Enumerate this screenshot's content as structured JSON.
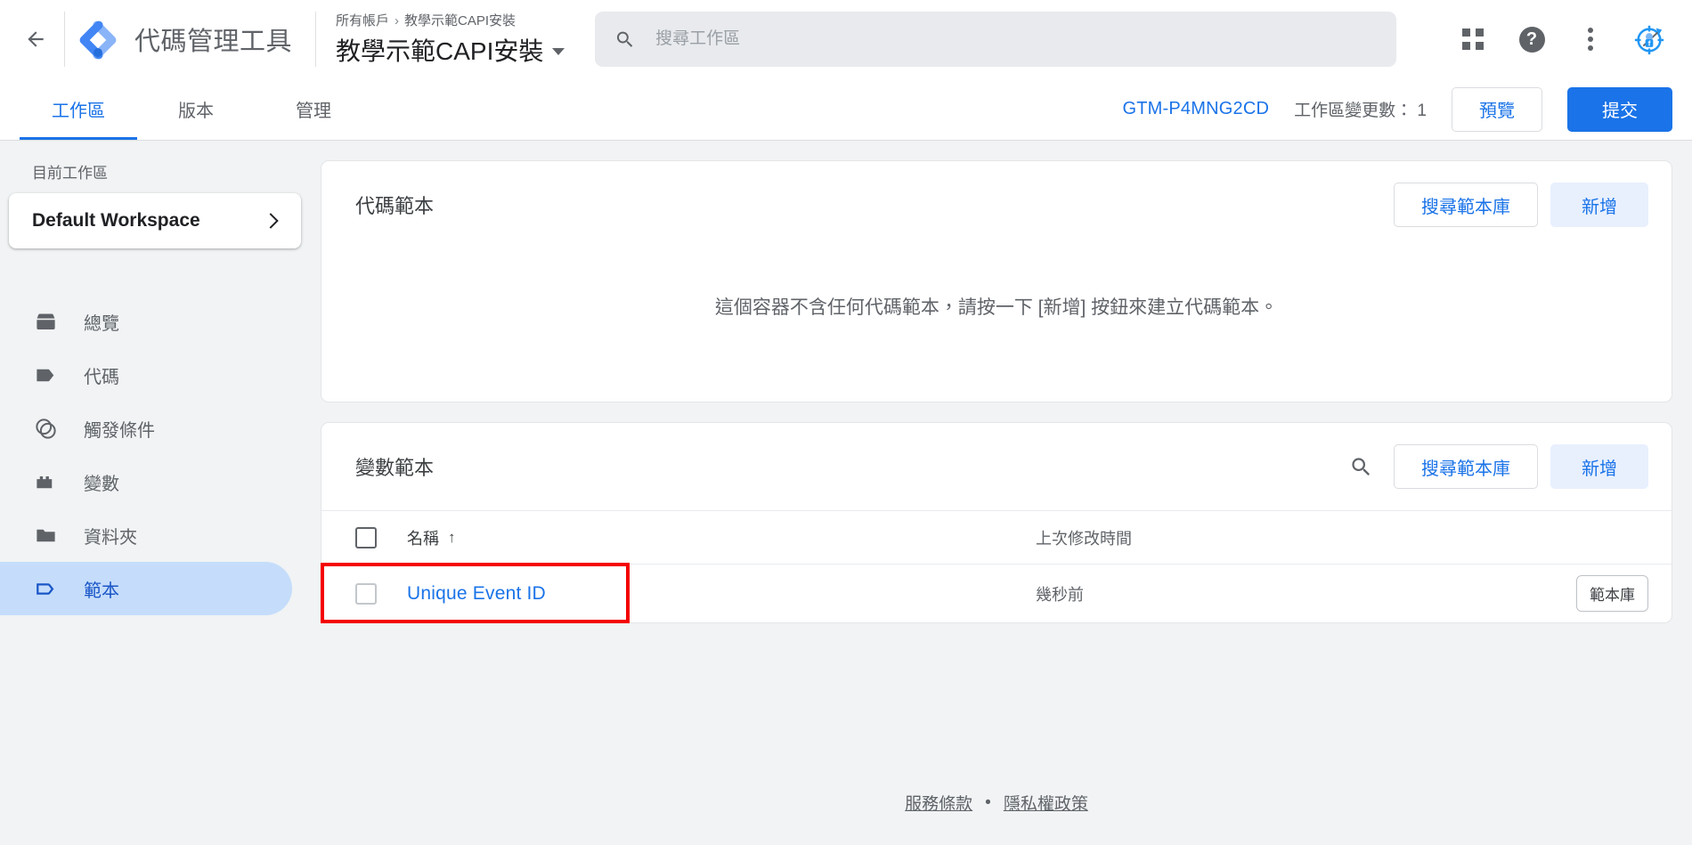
{
  "header": {
    "back_icon": "arrow-left-icon",
    "logo_icon": "gtm-logo-icon",
    "product_name": "代碼管理工具",
    "breadcrumb": {
      "account": "所有帳戶",
      "separator": "›",
      "container": "教學示範CAPI安裝"
    },
    "container_title": "教學示範CAPI安裝",
    "search": {
      "icon": "search-icon",
      "placeholder": "搜尋工作區",
      "value": ""
    },
    "actions": [
      {
        "name": "apps-grid-icon",
        "label": "Google 應用程式"
      },
      {
        "name": "help-icon",
        "label": "?"
      },
      {
        "name": "more-vert-icon",
        "label": "更多選項"
      },
      {
        "name": "account-avatar-icon",
        "label": "帳戶"
      }
    ]
  },
  "tabs": [
    {
      "label": "工作區",
      "active": true
    },
    {
      "label": "版本",
      "active": false
    },
    {
      "label": "管理",
      "active": false
    }
  ],
  "tabbar": {
    "gtm_id": "GTM-P4MNG2CD",
    "changes_label": "工作區變更數：",
    "changes_count": "1",
    "changes_text": "工作區變更數： 1",
    "preview_label": "預覽",
    "submit_label": "提交"
  },
  "sidebar": {
    "current_ws_label": "目前工作區",
    "workspace_name": "Default Workspace",
    "chevron_icon": "chevron-right-icon",
    "items": [
      {
        "label": "總覽",
        "icon": "overview-box-icon",
        "active": false
      },
      {
        "label": "代碼",
        "icon": "tag-filled-icon",
        "active": false
      },
      {
        "label": "觸發條件",
        "icon": "trigger-circles-icon",
        "active": false
      },
      {
        "label": "變數",
        "icon": "variables-blocks-icon",
        "active": false
      },
      {
        "label": "資料夾",
        "icon": "folder-icon",
        "active": false
      },
      {
        "label": "範本",
        "icon": "template-tag-outline-icon",
        "active": true
      }
    ]
  },
  "main": {
    "tag_templates_card": {
      "title": "代碼範本",
      "gallery_button": "搜尋範本庫",
      "new_button": "新增",
      "empty_message": "這個容器不含任何代碼範本，請按一下 [新增] 按鈕來建立代碼範本。"
    },
    "variable_templates_card": {
      "title": "變數範本",
      "search_icon": "search-icon",
      "gallery_button": "搜尋範本庫",
      "new_button": "新增",
      "table": {
        "columns": [
          {
            "key": "name",
            "label": "名稱",
            "sort": "↑"
          },
          {
            "key": "modified",
            "label": "上次修改時間"
          }
        ],
        "rows": [
          {
            "name": "Unique Event ID",
            "modified": "幾秒前",
            "badge": "範本庫",
            "highlighted": true
          }
        ]
      }
    }
  },
  "footer": {
    "terms": "服務條款",
    "separator": "•",
    "privacy": "隱私權政策"
  },
  "colors": {
    "accent_blue": "#1a73e8",
    "light_blue_bg": "#e8f0fe",
    "active_nav_bg": "#c5ddfb",
    "page_bg": "#f1f3f4",
    "text_primary": "#202124",
    "text_secondary": "#5f6368",
    "highlight_red": "#f40000"
  }
}
